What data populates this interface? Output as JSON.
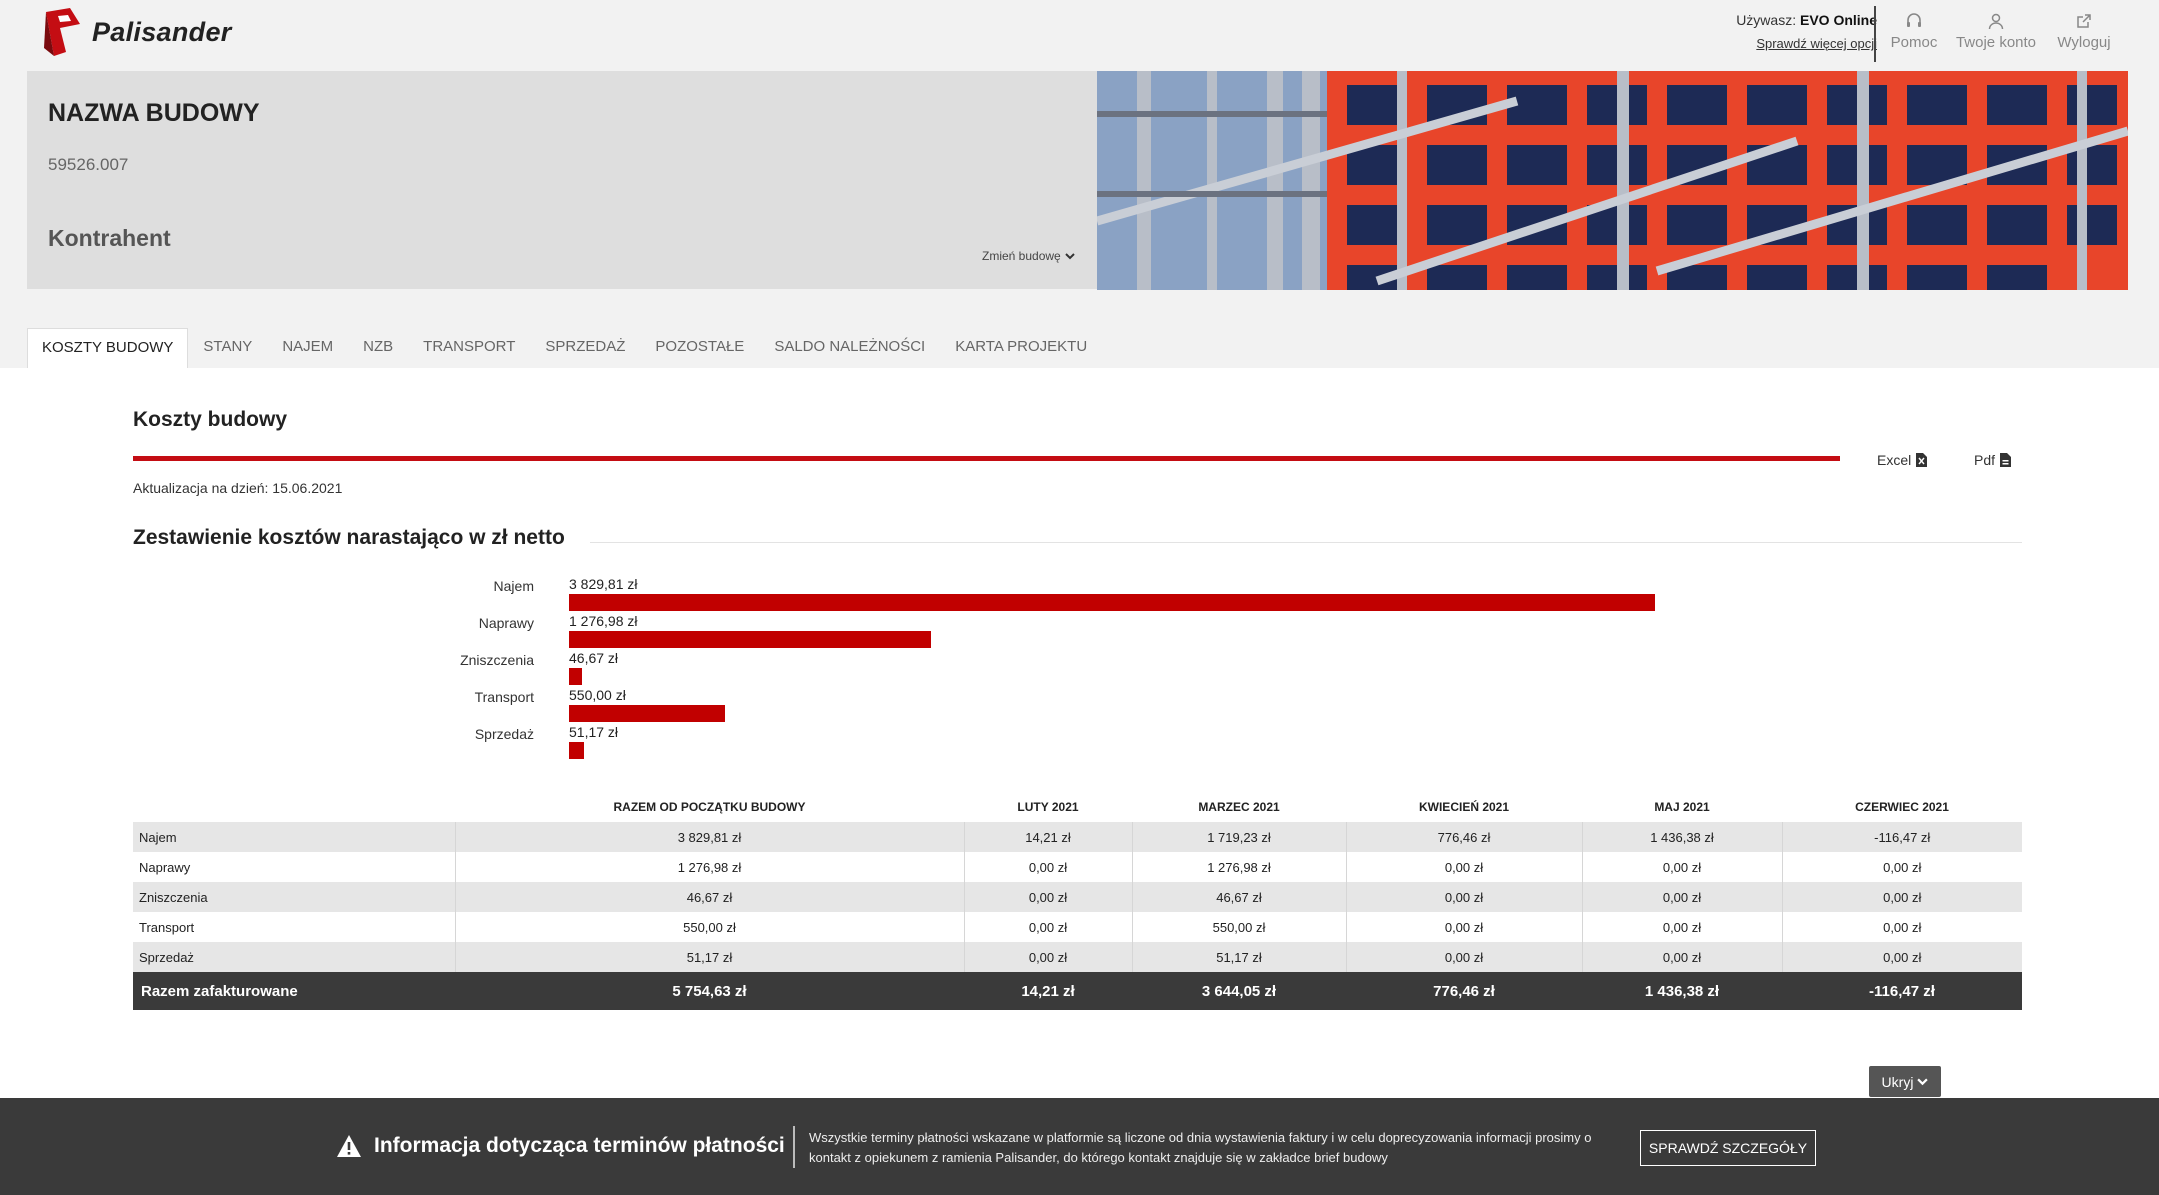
{
  "header": {
    "logo_text": "Palisander",
    "user_prefix": "Używasz:",
    "user_name": "EVO Online",
    "more_options": "Sprawdź więcej opcji",
    "actions": [
      {
        "label": "Pomoc",
        "icon": "headset-icon"
      },
      {
        "label": "Twoje konto",
        "icon": "user-icon"
      },
      {
        "label": "Wyloguj",
        "icon": "external-link-icon"
      }
    ]
  },
  "site": {
    "name": "NAZWA BUDOWY",
    "number": "59526.007",
    "client": "Kontrahent",
    "change_label": "Zmień budowę"
  },
  "tabs": [
    "KOSZTY BUDOWY",
    "STANY",
    "NAJEM",
    "NZB",
    "TRANSPORT",
    "SPRZEDAŻ",
    "POZOSTAŁE",
    "SALDO NALEŻNOŚCI",
    "KARTA PROJEKTU"
  ],
  "active_tab": 0,
  "main": {
    "title": "Koszty budowy",
    "export_excel": "Excel",
    "export_pdf": "Pdf",
    "update_text": "Aktualizacja na dzień: 15.06.2021",
    "subtitle": "Zestawienie kosztów narastająco w zł netto",
    "hide_button": "Ukryj"
  },
  "chart_data": {
    "type": "bar",
    "orientation": "horizontal",
    "title": "Zestawienie kosztów narastająco w zł netto",
    "categories": [
      "Najem",
      "Naprawy",
      "Zniszczenia",
      "Transport",
      "Sprzedaż"
    ],
    "values": [
      3829.81,
      1276.98,
      46.67,
      550.0,
      51.17
    ],
    "value_labels": [
      "3 829,81 zł",
      "1 276,98 zł",
      "46,67 zł",
      "550,00 zł",
      "51,17 zł"
    ],
    "xlim": [
      0,
      3829.81
    ],
    "color": "#c10000"
  },
  "table": {
    "columns": [
      "",
      "RAZEM OD POCZĄTKU BUDOWY",
      "LUTY 2021",
      "MARZEC 2021",
      "KWIECIEŃ 2021",
      "MAJ 2021",
      "CZERWIEC 2021"
    ],
    "rows": [
      [
        "Najem",
        "3 829,81 zł",
        "14,21 zł",
        "1 719,23 zł",
        "776,46 zł",
        "1 436,38 zł",
        "-116,47 zł"
      ],
      [
        "Naprawy",
        "1 276,98 zł",
        "0,00 zł",
        "1 276,98 zł",
        "0,00 zł",
        "0,00 zł",
        "0,00 zł"
      ],
      [
        "Zniszczenia",
        "46,67 zł",
        "0,00 zł",
        "46,67 zł",
        "0,00 zł",
        "0,00 zł",
        "0,00 zł"
      ],
      [
        "Transport",
        "550,00 zł",
        "0,00 zł",
        "550,00 zł",
        "0,00 zł",
        "0,00 zł",
        "0,00 zł"
      ],
      [
        "Sprzedaż",
        "51,17 zł",
        "0,00 zł",
        "51,17 zł",
        "0,00 zł",
        "0,00 zł",
        "0,00 zł"
      ]
    ],
    "total": [
      "Razem zafakturowane",
      "5 754,63 zł",
      "14,21 zł",
      "3 644,05 zł",
      "776,46 zł",
      "1 436,38 zł",
      "-116,47 zł"
    ]
  },
  "notice": {
    "title": "Informacja dotycząca terminów płatności",
    "text": "Wszystkie terminy płatności wskazane w platformie są liczone od dnia wystawienia faktury i w celu doprecyzowania informacji prosimy o kontakt z opiekunem z ramienia Palisander, do którego kontakt znajduje się w zakładce brief budowy",
    "button": "SPRAWDŹ SZCZEGÓŁY"
  },
  "colors": {
    "brand_red": "#c40d13",
    "bar_red": "#c10000",
    "dark_bar": "#3a3a3a"
  }
}
